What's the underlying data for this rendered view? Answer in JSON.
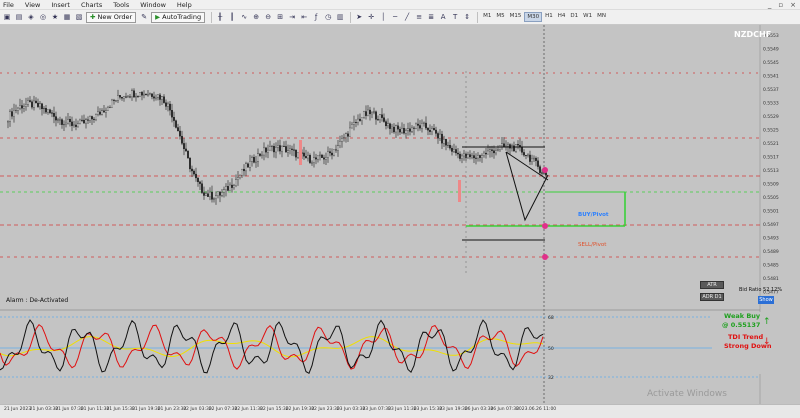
{
  "menu": [
    "File",
    "View",
    "Insert",
    "Charts",
    "Tools",
    "Window",
    "Help"
  ],
  "toolbar": {
    "new_order_label": "New Order",
    "autotrading_label": "AutoTrading",
    "timeframes": [
      "M1",
      "M5",
      "M15",
      "M30",
      "H1",
      "H4",
      "D1",
      "W1",
      "MN"
    ],
    "active_timeframe": "M30"
  },
  "chart": {
    "symbol": "NZDCHF",
    "tick_labels_right": [
      "0.5553",
      "0.5549",
      "0.5545",
      "0.5541",
      "0.5537",
      "0.5533",
      "0.5529",
      "0.5525",
      "0.5521",
      "0.5517",
      "0.5513",
      "0.5509",
      "0.5505",
      "0.5501",
      "0.5497",
      "0.5493",
      "0.5489",
      "0.5485",
      "0.5481",
      "0.5477"
    ],
    "labels": {
      "buy_pivot": "BUY/Pivot",
      "sell_pivot": "SELL/Pivot",
      "alarm": "Alarm : De-Activated",
      "atr": "ATR",
      "adr": "ADR D1",
      "bid_ratio": "Bid Ratio 52.12%",
      "show": "Show",
      "weak_buy": "Weak Buy",
      "weak_buy_price": "@ 0.55137",
      "tdi_trend": "TDI Trend",
      "strong_down": "Strong Down",
      "watermark": "Activate Windows"
    },
    "osc_levels": [
      "68",
      "50",
      "32"
    ],
    "time_labels": [
      "21 Jun 2023",
      "21 Jun 03:30",
      "21 Jun 07:30",
      "21 Jun 11:30",
      "21 Jun 15:30",
      "21 Jun 19:30",
      "21 Jun 23:30",
      "22 Jun 03:30",
      "22 Jun 07:30",
      "22 Jun 11:30",
      "22 Jun 15:30",
      "22 Jun 19:30",
      "22 Jun 23:30",
      "23 Jun 03:30",
      "23 Jun 07:30",
      "23 Jun 11:30",
      "23 Jun 15:30",
      "23 Jun 19:30",
      "26 Jun 03:30",
      "26 Jun 07:30",
      "2023.06.26 11:00"
    ],
    "colors": {
      "background": "#c4c4c4",
      "candle": "#1a1a1a",
      "buy": "#2a7fff",
      "sell": "#e0502a",
      "green_line": "#3ad13a",
      "red_dashed": "#d33a3a",
      "tdi_red": "#e01010",
      "tdi_yellow": "#f0e000",
      "tdi_blue": "#2a9fff"
    }
  }
}
